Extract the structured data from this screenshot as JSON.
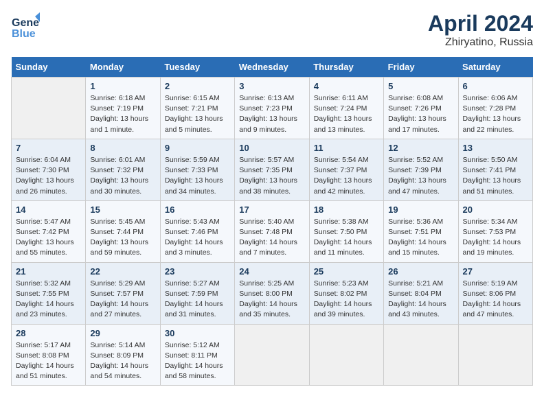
{
  "logo": {
    "line1": "General",
    "line2": "Blue"
  },
  "title": "April 2024",
  "subtitle": "Zhiryatino, Russia",
  "days_header": [
    "Sunday",
    "Monday",
    "Tuesday",
    "Wednesday",
    "Thursday",
    "Friday",
    "Saturday"
  ],
  "weeks": [
    [
      {
        "num": "",
        "info": ""
      },
      {
        "num": "1",
        "info": "Sunrise: 6:18 AM\nSunset: 7:19 PM\nDaylight: 13 hours\nand 1 minute."
      },
      {
        "num": "2",
        "info": "Sunrise: 6:15 AM\nSunset: 7:21 PM\nDaylight: 13 hours\nand 5 minutes."
      },
      {
        "num": "3",
        "info": "Sunrise: 6:13 AM\nSunset: 7:23 PM\nDaylight: 13 hours\nand 9 minutes."
      },
      {
        "num": "4",
        "info": "Sunrise: 6:11 AM\nSunset: 7:24 PM\nDaylight: 13 hours\nand 13 minutes."
      },
      {
        "num": "5",
        "info": "Sunrise: 6:08 AM\nSunset: 7:26 PM\nDaylight: 13 hours\nand 17 minutes."
      },
      {
        "num": "6",
        "info": "Sunrise: 6:06 AM\nSunset: 7:28 PM\nDaylight: 13 hours\nand 22 minutes."
      }
    ],
    [
      {
        "num": "7",
        "info": "Sunrise: 6:04 AM\nSunset: 7:30 PM\nDaylight: 13 hours\nand 26 minutes."
      },
      {
        "num": "8",
        "info": "Sunrise: 6:01 AM\nSunset: 7:32 PM\nDaylight: 13 hours\nand 30 minutes."
      },
      {
        "num": "9",
        "info": "Sunrise: 5:59 AM\nSunset: 7:33 PM\nDaylight: 13 hours\nand 34 minutes."
      },
      {
        "num": "10",
        "info": "Sunrise: 5:57 AM\nSunset: 7:35 PM\nDaylight: 13 hours\nand 38 minutes."
      },
      {
        "num": "11",
        "info": "Sunrise: 5:54 AM\nSunset: 7:37 PM\nDaylight: 13 hours\nand 42 minutes."
      },
      {
        "num": "12",
        "info": "Sunrise: 5:52 AM\nSunset: 7:39 PM\nDaylight: 13 hours\nand 47 minutes."
      },
      {
        "num": "13",
        "info": "Sunrise: 5:50 AM\nSunset: 7:41 PM\nDaylight: 13 hours\nand 51 minutes."
      }
    ],
    [
      {
        "num": "14",
        "info": "Sunrise: 5:47 AM\nSunset: 7:42 PM\nDaylight: 13 hours\nand 55 minutes."
      },
      {
        "num": "15",
        "info": "Sunrise: 5:45 AM\nSunset: 7:44 PM\nDaylight: 13 hours\nand 59 minutes."
      },
      {
        "num": "16",
        "info": "Sunrise: 5:43 AM\nSunset: 7:46 PM\nDaylight: 14 hours\nand 3 minutes."
      },
      {
        "num": "17",
        "info": "Sunrise: 5:40 AM\nSunset: 7:48 PM\nDaylight: 14 hours\nand 7 minutes."
      },
      {
        "num": "18",
        "info": "Sunrise: 5:38 AM\nSunset: 7:50 PM\nDaylight: 14 hours\nand 11 minutes."
      },
      {
        "num": "19",
        "info": "Sunrise: 5:36 AM\nSunset: 7:51 PM\nDaylight: 14 hours\nand 15 minutes."
      },
      {
        "num": "20",
        "info": "Sunrise: 5:34 AM\nSunset: 7:53 PM\nDaylight: 14 hours\nand 19 minutes."
      }
    ],
    [
      {
        "num": "21",
        "info": "Sunrise: 5:32 AM\nSunset: 7:55 PM\nDaylight: 14 hours\nand 23 minutes."
      },
      {
        "num": "22",
        "info": "Sunrise: 5:29 AM\nSunset: 7:57 PM\nDaylight: 14 hours\nand 27 minutes."
      },
      {
        "num": "23",
        "info": "Sunrise: 5:27 AM\nSunset: 7:59 PM\nDaylight: 14 hours\nand 31 minutes."
      },
      {
        "num": "24",
        "info": "Sunrise: 5:25 AM\nSunset: 8:00 PM\nDaylight: 14 hours\nand 35 minutes."
      },
      {
        "num": "25",
        "info": "Sunrise: 5:23 AM\nSunset: 8:02 PM\nDaylight: 14 hours\nand 39 minutes."
      },
      {
        "num": "26",
        "info": "Sunrise: 5:21 AM\nSunset: 8:04 PM\nDaylight: 14 hours\nand 43 minutes."
      },
      {
        "num": "27",
        "info": "Sunrise: 5:19 AM\nSunset: 8:06 PM\nDaylight: 14 hours\nand 47 minutes."
      }
    ],
    [
      {
        "num": "28",
        "info": "Sunrise: 5:17 AM\nSunset: 8:08 PM\nDaylight: 14 hours\nand 51 minutes."
      },
      {
        "num": "29",
        "info": "Sunrise: 5:14 AM\nSunset: 8:09 PM\nDaylight: 14 hours\nand 54 minutes."
      },
      {
        "num": "30",
        "info": "Sunrise: 5:12 AM\nSunset: 8:11 PM\nDaylight: 14 hours\nand 58 minutes."
      },
      {
        "num": "",
        "info": ""
      },
      {
        "num": "",
        "info": ""
      },
      {
        "num": "",
        "info": ""
      },
      {
        "num": "",
        "info": ""
      }
    ]
  ]
}
